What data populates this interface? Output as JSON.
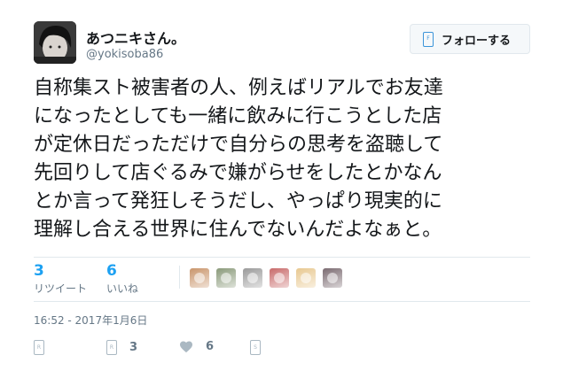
{
  "user": {
    "display_name": "あつニキさん。",
    "handle": "@yokisoba86"
  },
  "follow_button": {
    "icon": "follow-icon",
    "icon_glyph": "F",
    "label": "フォローする"
  },
  "tweet": {
    "lines": [
      "自称集スト被害者の人、例えばリアルでお友達",
      "になったとしても一緒に飲みに行こうとした店",
      "が定休日だっただけで自分らの思考を盗聴して",
      "先回りして店ぐるみで嫌がらせをしたとかなん",
      "とか言って発狂しそうだし、やっぱり現実的に",
      "理解し合える世界に住んでないんだよなぁと。"
    ]
  },
  "stats": {
    "retweets": {
      "count": "3",
      "label": "リツイート"
    },
    "likes": {
      "count": "6",
      "label": "いいね"
    }
  },
  "likers": [
    {
      "name": "liker-1",
      "color": "#c9956b"
    },
    {
      "name": "liker-2",
      "color": "#8a9a7a"
    },
    {
      "name": "liker-3",
      "color": "#9a9a9a"
    },
    {
      "name": "liker-4",
      "color": "#c86a6a"
    },
    {
      "name": "liker-5",
      "color": "#e8c890"
    },
    {
      "name": "liker-6",
      "color": "#7a6a70"
    }
  ],
  "timestamp": "16:52 - 2017年1月6日",
  "actions": {
    "reply": {
      "icon": "reply-icon"
    },
    "retweet": {
      "icon": "retweet-icon",
      "count": "3"
    },
    "like": {
      "icon": "heart-icon",
      "count": "6"
    },
    "share": {
      "icon": "share-icon"
    }
  },
  "colors": {
    "accent": "#1da1f2",
    "text": "#14171a",
    "muted": "#657786",
    "border": "#e1e8ed"
  }
}
